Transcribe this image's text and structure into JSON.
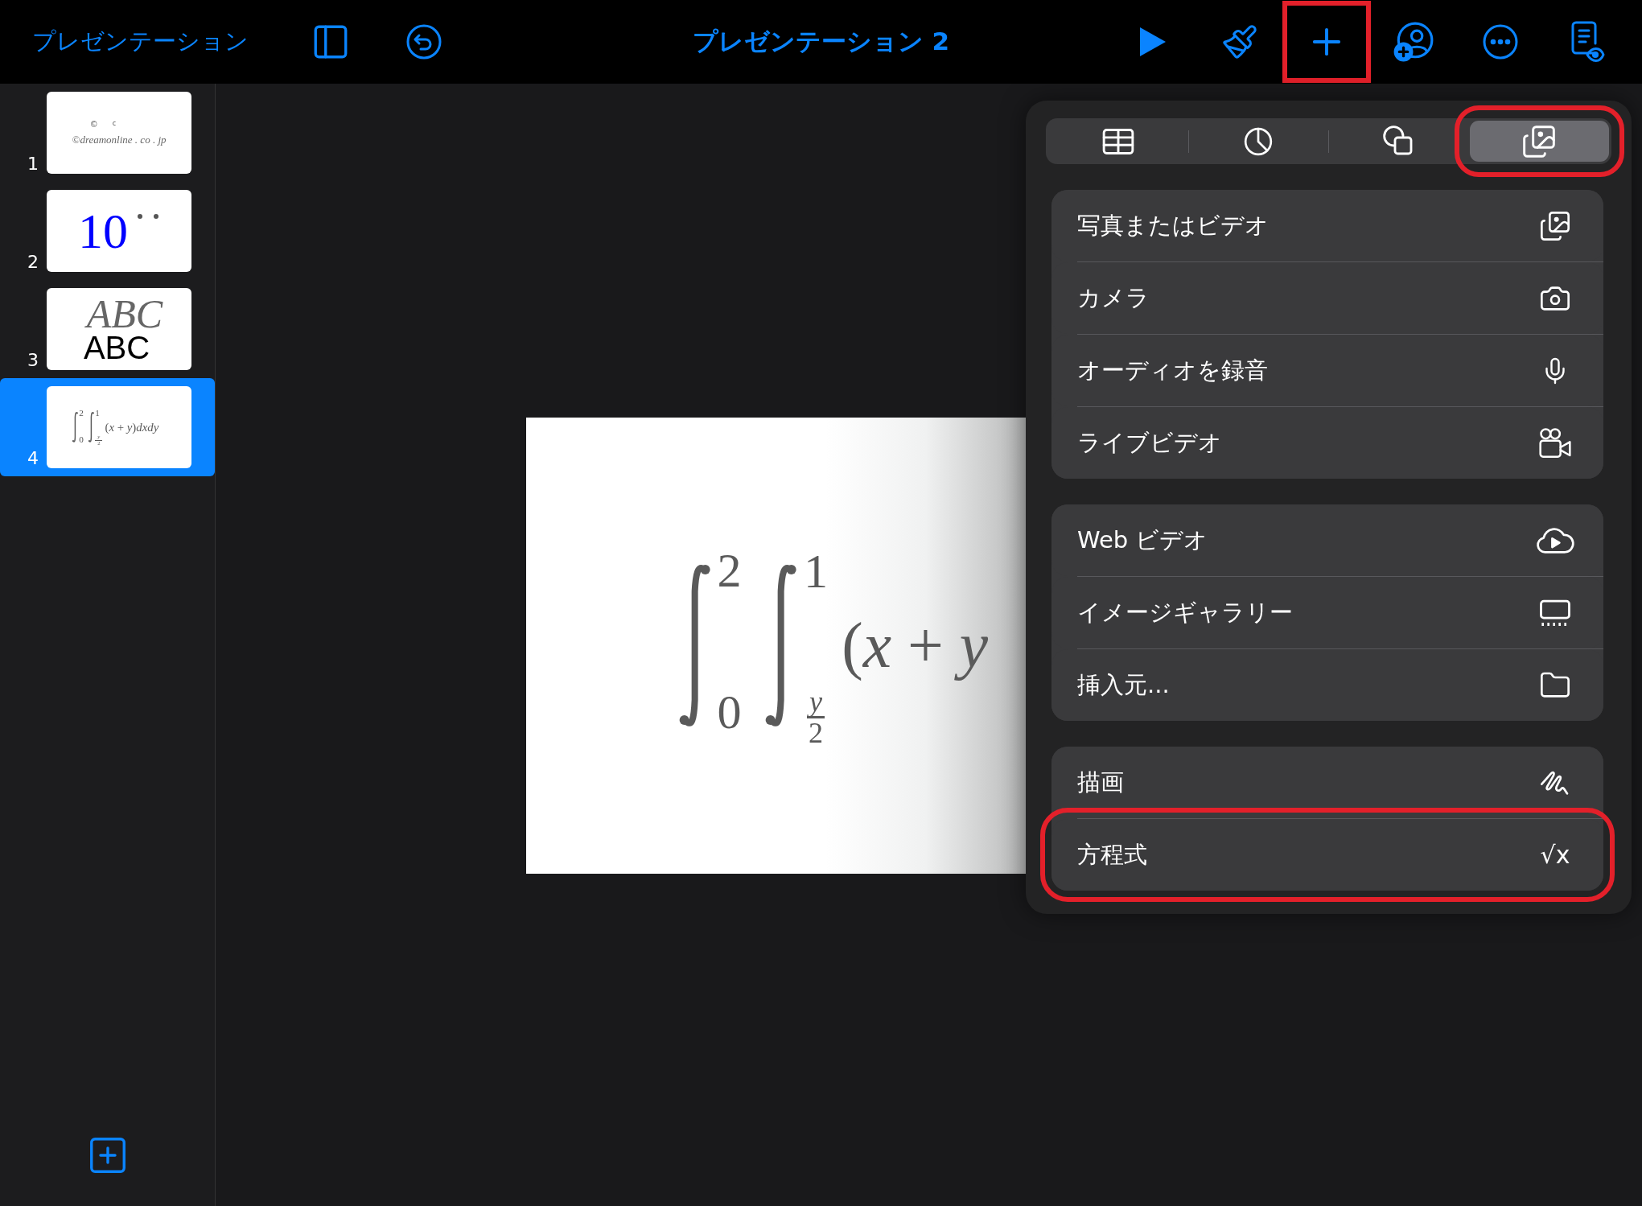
{
  "toolbar": {
    "back": "プレゼンテーション",
    "title": "プレゼンテーション 2",
    "left_tools": [
      {
        "kind": "sidebar"
      },
      {
        "kind": "undo"
      }
    ],
    "tools": [
      {
        "kind": "play",
        "highlighted": false
      },
      {
        "kind": "brush",
        "highlighted": false
      },
      {
        "kind": "add",
        "highlighted": true
      },
      {
        "kind": "collaborate",
        "highlighted": false
      },
      {
        "kind": "more",
        "highlighted": false
      },
      {
        "kind": "reader",
        "highlighted": false
      }
    ]
  },
  "slides": [
    {
      "number": "1",
      "selected": false,
      "kind": "credit",
      "marks": [
        "©",
        "c"
      ],
      "text": "©dreamonline . co . jp"
    },
    {
      "number": "2",
      "selected": false,
      "kind": "number",
      "text": "10"
    },
    {
      "number": "3",
      "selected": false,
      "kind": "letters",
      "italic_text": "ABC",
      "text": "ABC"
    },
    {
      "number": "4",
      "selected": true,
      "kind": "equation",
      "upper_1": "2",
      "lower_1": "0",
      "upper_2": "1",
      "lower_2_num": "y",
      "lower_2_den": "2",
      "body": "(*x* + *y*)*dxdy*"
    }
  ],
  "current_slide": {
    "upper_1": "2",
    "lower_1": "0",
    "upper_2": "1",
    "lower_2_num": "y",
    "lower_2_den": "2",
    "body": "(*x* + *y*"
  },
  "insert_menu": {
    "tabs": [
      {
        "kind": "table",
        "selected": false,
        "highlighted": false
      },
      {
        "kind": "chart",
        "selected": false,
        "highlighted": false
      },
      {
        "kind": "shape",
        "selected": false,
        "highlighted": false
      },
      {
        "kind": "media",
        "selected": true,
        "highlighted": true
      }
    ],
    "groups": [
      {
        "items": [
          {
            "kind": "photo",
            "label": "写真またはビデオ",
            "highlighted": false
          },
          {
            "kind": "camera",
            "label": "カメラ",
            "highlighted": false
          },
          {
            "kind": "audio",
            "label": "オーディオを録音",
            "highlighted": false
          },
          {
            "kind": "live",
            "label": "ライブビデオ",
            "highlighted": false
          }
        ]
      },
      {
        "items": [
          {
            "kind": "web",
            "label": "Web ビデオ",
            "highlighted": false
          },
          {
            "kind": "gallery",
            "label": "イメージギャラリー",
            "highlighted": false
          },
          {
            "kind": "folder",
            "label": "挿入元...",
            "highlighted": false
          }
        ]
      },
      {
        "items": [
          {
            "kind": "drawing",
            "label": "描画",
            "highlighted": false
          },
          {
            "kind": "equation",
            "label": "方程式",
            "symbol": "√x",
            "highlighted": true
          }
        ]
      }
    ]
  }
}
